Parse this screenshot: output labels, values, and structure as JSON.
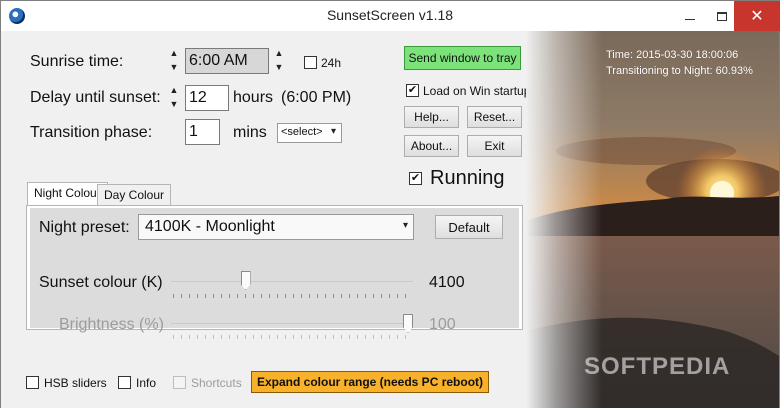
{
  "window": {
    "title": "SunsetScreen v1.18"
  },
  "settings": {
    "sunrise_label": "Sunrise time:",
    "sunrise_value": "6:00 AM",
    "h24_label": "24h",
    "delay_label": "Delay until sunset:",
    "delay_value": "12",
    "delay_unit": "hours",
    "delay_computed": "(6:00 PM)",
    "transition_label": "Transition phase:",
    "transition_value": "1",
    "transition_unit": "mins",
    "preset_select": "<select>"
  },
  "right_panel": {
    "send_tray": "Send window to tray",
    "load_startup": "Load on Win startup",
    "load_startup_checked": true,
    "help": "Help...",
    "reset": "Reset...",
    "about": "About...",
    "exit": "Exit",
    "running": "Running",
    "running_checked": true
  },
  "tabs": [
    {
      "label": "Night Colour",
      "active": true
    },
    {
      "label": "Day Colour",
      "active": false
    }
  ],
  "night_tab": {
    "preset_label": "Night preset:",
    "preset_value": "4100K - Moonlight",
    "default_button": "Default",
    "sunset_colour_label": "Sunset colour (K)",
    "sunset_colour_value": "4100",
    "sunset_colour_fraction": 0.3,
    "brightness_label": "Brightness (%)",
    "brightness_value": "100",
    "brightness_fraction": 1.0
  },
  "bottom": {
    "hsb": "HSB sliders",
    "info": "Info",
    "shortcuts": "Shortcuts",
    "expand": "Expand colour range (needs PC reboot)"
  },
  "overlay": {
    "time": "Time: 2015-03-30 18:00:06",
    "transition": "Transitioning to Night: 60.93%",
    "watermark": "SOFTPEDIA"
  },
  "colors": {
    "close_button": "#c7352d",
    "tray_button": "#7ce37a",
    "expand_button": "#f8b12a"
  }
}
